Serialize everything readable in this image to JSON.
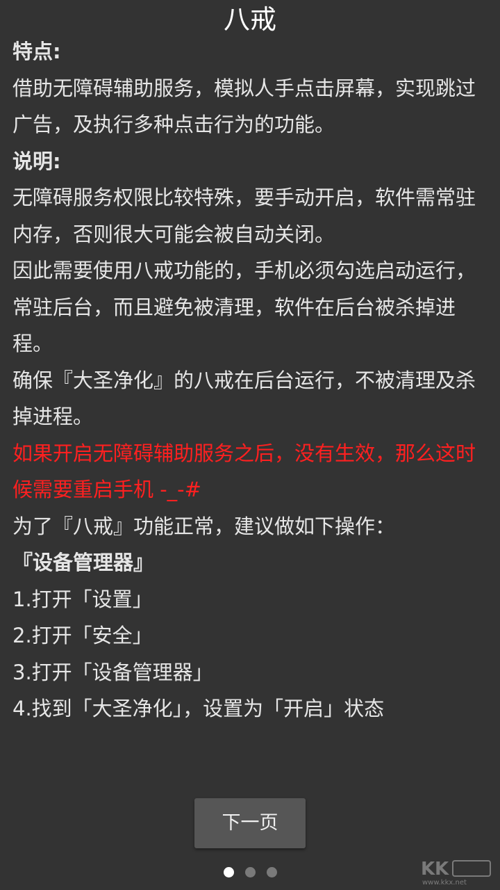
{
  "header": {
    "title": "八戒"
  },
  "content": {
    "features_heading": "特点:",
    "features_text": "借助无障碍辅助服务，模拟人手点击屏幕，实现跳过广告，及执行多种点击行为的功能。",
    "notes_heading": "说明:",
    "notes_p1": "无障碍服务权限比较特殊，要手动开启，软件需常驻内存，否则很大可能会被自动关闭。",
    "notes_p2": "因此需要使用八戒功能的，手机必须勾选启动运行，常驻后台，而且避免被清理，软件在后台被杀掉进程。",
    "notes_p3": "确保『大圣净化』的八戒在后台运行，不被清理及杀掉进程。",
    "warning": "如果开启无障碍辅助服务之后，没有生效，那么这时候需要重启手机 -_-#",
    "suggestion": "为了『八戒』功能正常，建议做如下操作：",
    "device_manager_heading": "『设备管理器』",
    "steps": [
      "1.打开「设置」",
      "2.打开「安全」",
      "3.打开「设备管理器」",
      "4.找到「大圣净化」，设置为「开启」状态"
    ]
  },
  "footer": {
    "next_label": "下一页",
    "page_indicator": {
      "current": 1,
      "total": 3
    }
  },
  "colors": {
    "background": "#333333",
    "text": "#e6e6e6",
    "warning": "#ff2020",
    "button": "#565656"
  },
  "watermark": {
    "text": "www.kkx.net"
  }
}
